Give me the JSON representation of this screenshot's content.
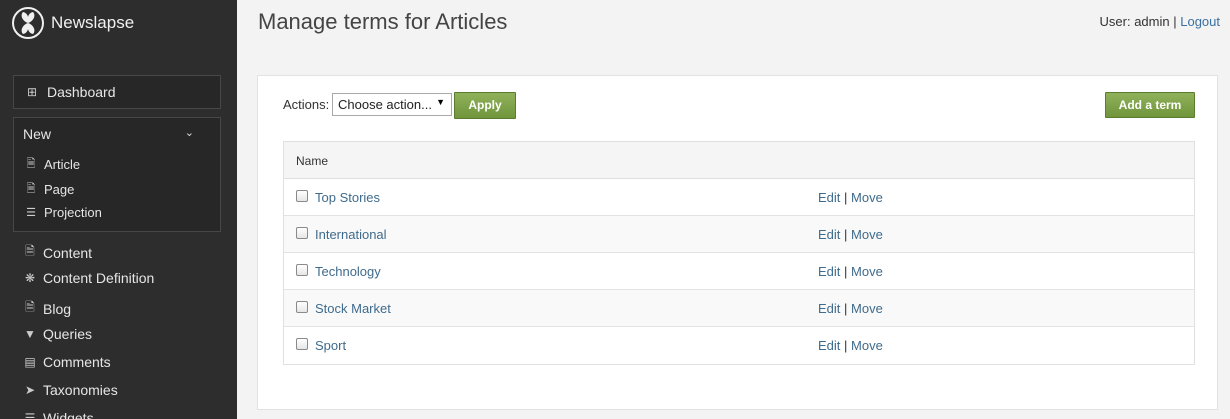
{
  "brand": {
    "name": "Newslapse"
  },
  "sidebar": {
    "dashboard": {
      "label": "Dashboard",
      "icon": "grid-icon"
    },
    "new_group": {
      "label": "New",
      "items": [
        {
          "label": "Article",
          "icon": "document-icon"
        },
        {
          "label": "Page",
          "icon": "document-icon"
        },
        {
          "label": "Projection",
          "icon": "list-document-icon"
        }
      ]
    },
    "items": [
      {
        "label": "Content",
        "icon": "document-icon"
      },
      {
        "label": "Content Definition",
        "icon": "puzzle-icon"
      },
      {
        "label": "Blog",
        "icon": "document-icon"
      },
      {
        "label": "Queries",
        "icon": "filter-icon"
      },
      {
        "label": "Comments",
        "icon": "comment-icon"
      },
      {
        "label": "Taxonomies",
        "icon": "tags-icon"
      },
      {
        "label": "Widgets",
        "icon": "widgets-icon"
      }
    ]
  },
  "page": {
    "title": "Manage terms for Articles"
  },
  "user": {
    "prefix": "User: ",
    "name": "admin",
    "separator": " | ",
    "logout": "Logout"
  },
  "toolbar": {
    "actions_label": "Actions:",
    "select_value": "Choose action...",
    "apply_label": "Apply",
    "add_term_label": "Add a term"
  },
  "table": {
    "header": "Name",
    "edit_label": "Edit",
    "separator": " | ",
    "move_label": "Move",
    "rows": [
      {
        "name": "Top Stories"
      },
      {
        "name": "International"
      },
      {
        "name": "Technology"
      },
      {
        "name": "Stock Market"
      },
      {
        "name": "Sport"
      }
    ]
  },
  "colors": {
    "sidebar_bg": "#2d2d2d",
    "button_green": "#7a9e45",
    "link": "#3f6b8c"
  }
}
